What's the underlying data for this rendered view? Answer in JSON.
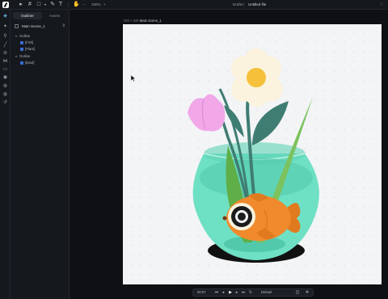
{
  "topbar": {
    "zoom": "100%",
    "breadcrumb_parent": "Drafts",
    "breadcrumb_sep": "/",
    "file_name": "Untitled file",
    "add_symbol": "+",
    "minus_symbol": "−"
  },
  "panel": {
    "tabs": [
      {
        "label": "Outliner",
        "active": true
      },
      {
        "label": "Assets",
        "active": false
      }
    ],
    "scene_label": "Main Scene_1",
    "tree": [
      {
        "label": "Outline",
        "level": 0,
        "arrow": "▾",
        "square": false
      },
      {
        "label": "[Fish]",
        "level": 1,
        "arrow": "",
        "square": true
      },
      {
        "label": "[Plant]",
        "level": 1,
        "arrow": "",
        "square": true
      },
      {
        "label": "Outline",
        "level": 0,
        "arrow": "▾",
        "square": false
      },
      {
        "label": "[Bowl]",
        "level": 1,
        "arrow": "",
        "square": true
      }
    ]
  },
  "canvas": {
    "size_label": "320 × 320",
    "scene_label": "Main Scene_1"
  },
  "player": {
    "time": "00:07",
    "state": "Default"
  },
  "icons": {
    "topbar": [
      "pointer-icon",
      "frame-icon",
      "shape-icon",
      "pen-icon",
      "text-icon",
      "hand-icon"
    ],
    "rail": [
      "layers-icon",
      "design-icon",
      "assets-icon",
      "pen-tool-icon",
      "link-icon",
      "code-icon",
      "image-icon",
      "eye-icon",
      "settings-icon",
      "help-icon",
      "history-icon"
    ]
  },
  "colors": {
    "accent": "#6cc4ff",
    "bowl": "#6ee0c4",
    "fish": "#f08a2c",
    "flower_yellow": "#f5c13a",
    "tulip_pink": "#f1a7e8",
    "leaf_dark": "#3f7d73",
    "leaf_green": "#5fae47"
  }
}
